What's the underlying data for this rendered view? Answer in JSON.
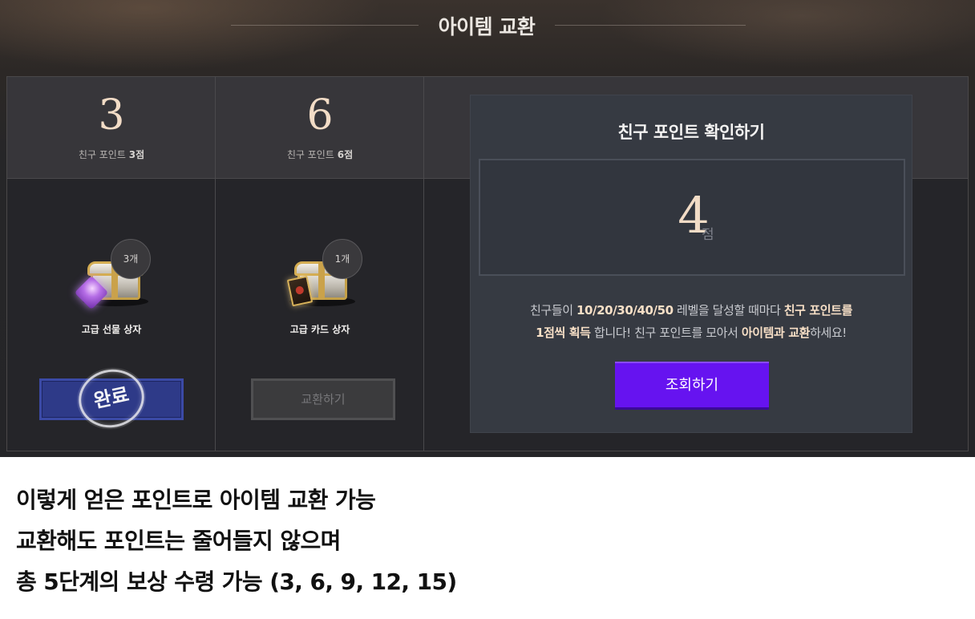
{
  "section": {
    "title": "아이템 교환"
  },
  "rewards": [
    {
      "step": "3",
      "label_prefix": "친구 포인트 ",
      "label_points": "3점",
      "count": "3개",
      "item_name": "고급 선물 상자",
      "icon": "gift-box-icon",
      "status": "완료"
    },
    {
      "step": "6",
      "label_prefix": "친구 포인트 ",
      "label_points": "6점",
      "count": "1개",
      "item_name": "고급 카드 상자",
      "icon": "card-box-icon",
      "button_label": "교환하기"
    }
  ],
  "check": {
    "title": "친구 포인트 확인하기",
    "points": "4",
    "points_unit": "점",
    "desc_1a": "친구들이 ",
    "desc_1b": "10/20/30/40/50",
    "desc_1c": " 레벨을 달성할 때마다 ",
    "desc_1d": "친구 포인트를",
    "desc_2a": "1점씩 획득",
    "desc_2b": " 합니다! 친구 포인트를 모아서 ",
    "desc_2c": "아이템과 교환",
    "desc_2d": "하세요!",
    "button_label": "조회하기"
  },
  "caption": {
    "lines": [
      "이렇게 얻은 포인트로 아이템 교환 가능",
      "교환해도 포인트는 줄어들지 않으며",
      "총 5단계의 보상 수령 가능 (3, 6, 9, 12, 15)"
    ]
  },
  "colors": {
    "accent_gold": "#f2dcc6",
    "lookup_button": "#6613f0",
    "done_button": "#2e3a88"
  }
}
